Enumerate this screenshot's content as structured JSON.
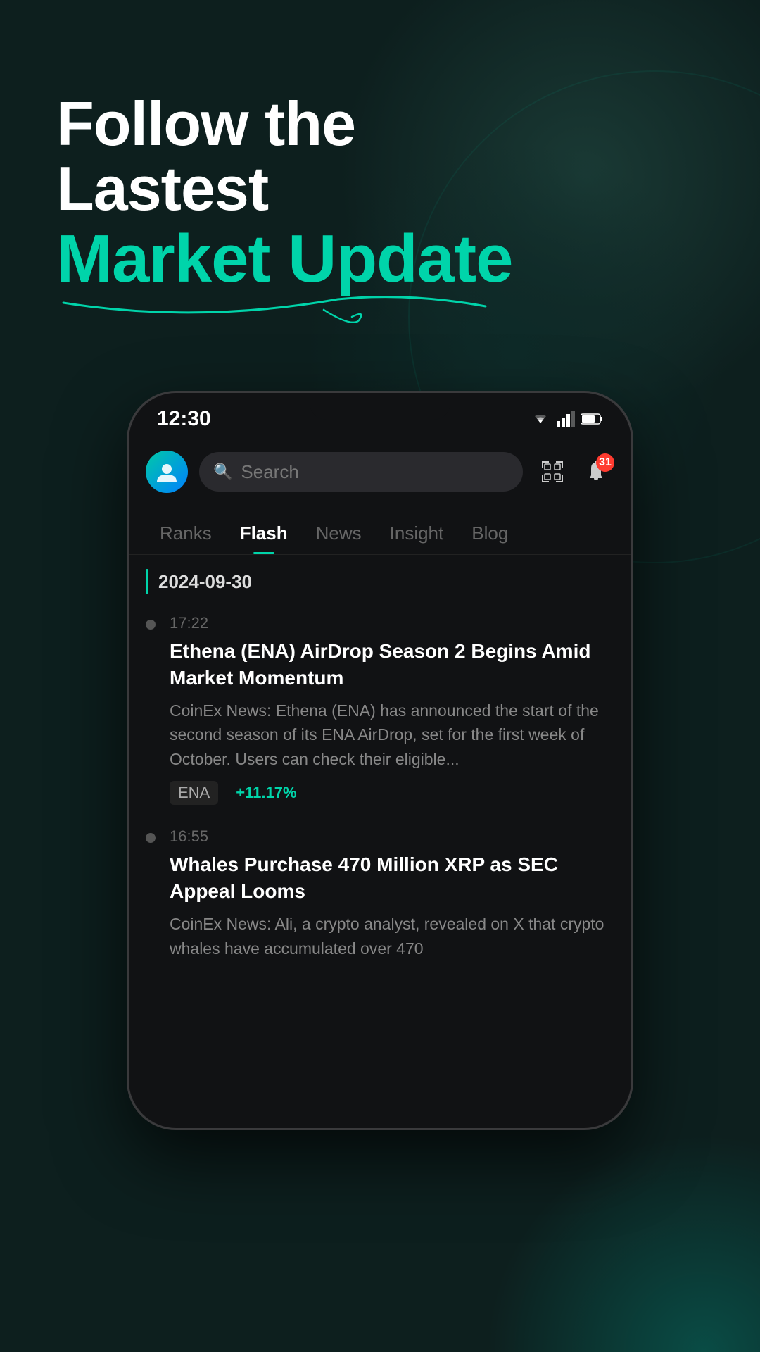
{
  "hero": {
    "line1": "Follow the",
    "line2": "Lastest",
    "accent": "Market Update"
  },
  "phone": {
    "status_time": "12:30",
    "search_placeholder": "Search",
    "notification_count": "31",
    "tabs": [
      {
        "label": "Ranks",
        "active": false
      },
      {
        "label": "Flash",
        "active": true
      },
      {
        "label": "News",
        "active": false
      },
      {
        "label": "Insight",
        "active": false
      },
      {
        "label": "Blog",
        "active": false
      }
    ],
    "date_header": "2024-09-30",
    "news": [
      {
        "time": "17:22",
        "title": "Ethena (ENA) AirDrop Season 2 Begins Amid Market Momentum",
        "excerpt": "CoinEx News: Ethena (ENA) has announced the start of the second season of its ENA AirDrop, set for the first week of October. Users can check their eligible...",
        "tag": "ENA",
        "change": "+11.17%"
      },
      {
        "time": "16:55",
        "title": "Whales Purchase 470 Million XRP as SEC Appeal Looms",
        "excerpt": "CoinEx News: Ali, a crypto analyst, revealed on X that crypto whales have accumulated over 470",
        "tag": "",
        "change": ""
      }
    ]
  },
  "colors": {
    "accent": "#00d4aa",
    "background": "#0d1f1e",
    "phone_bg": "#111214",
    "positive": "#00d4aa"
  }
}
